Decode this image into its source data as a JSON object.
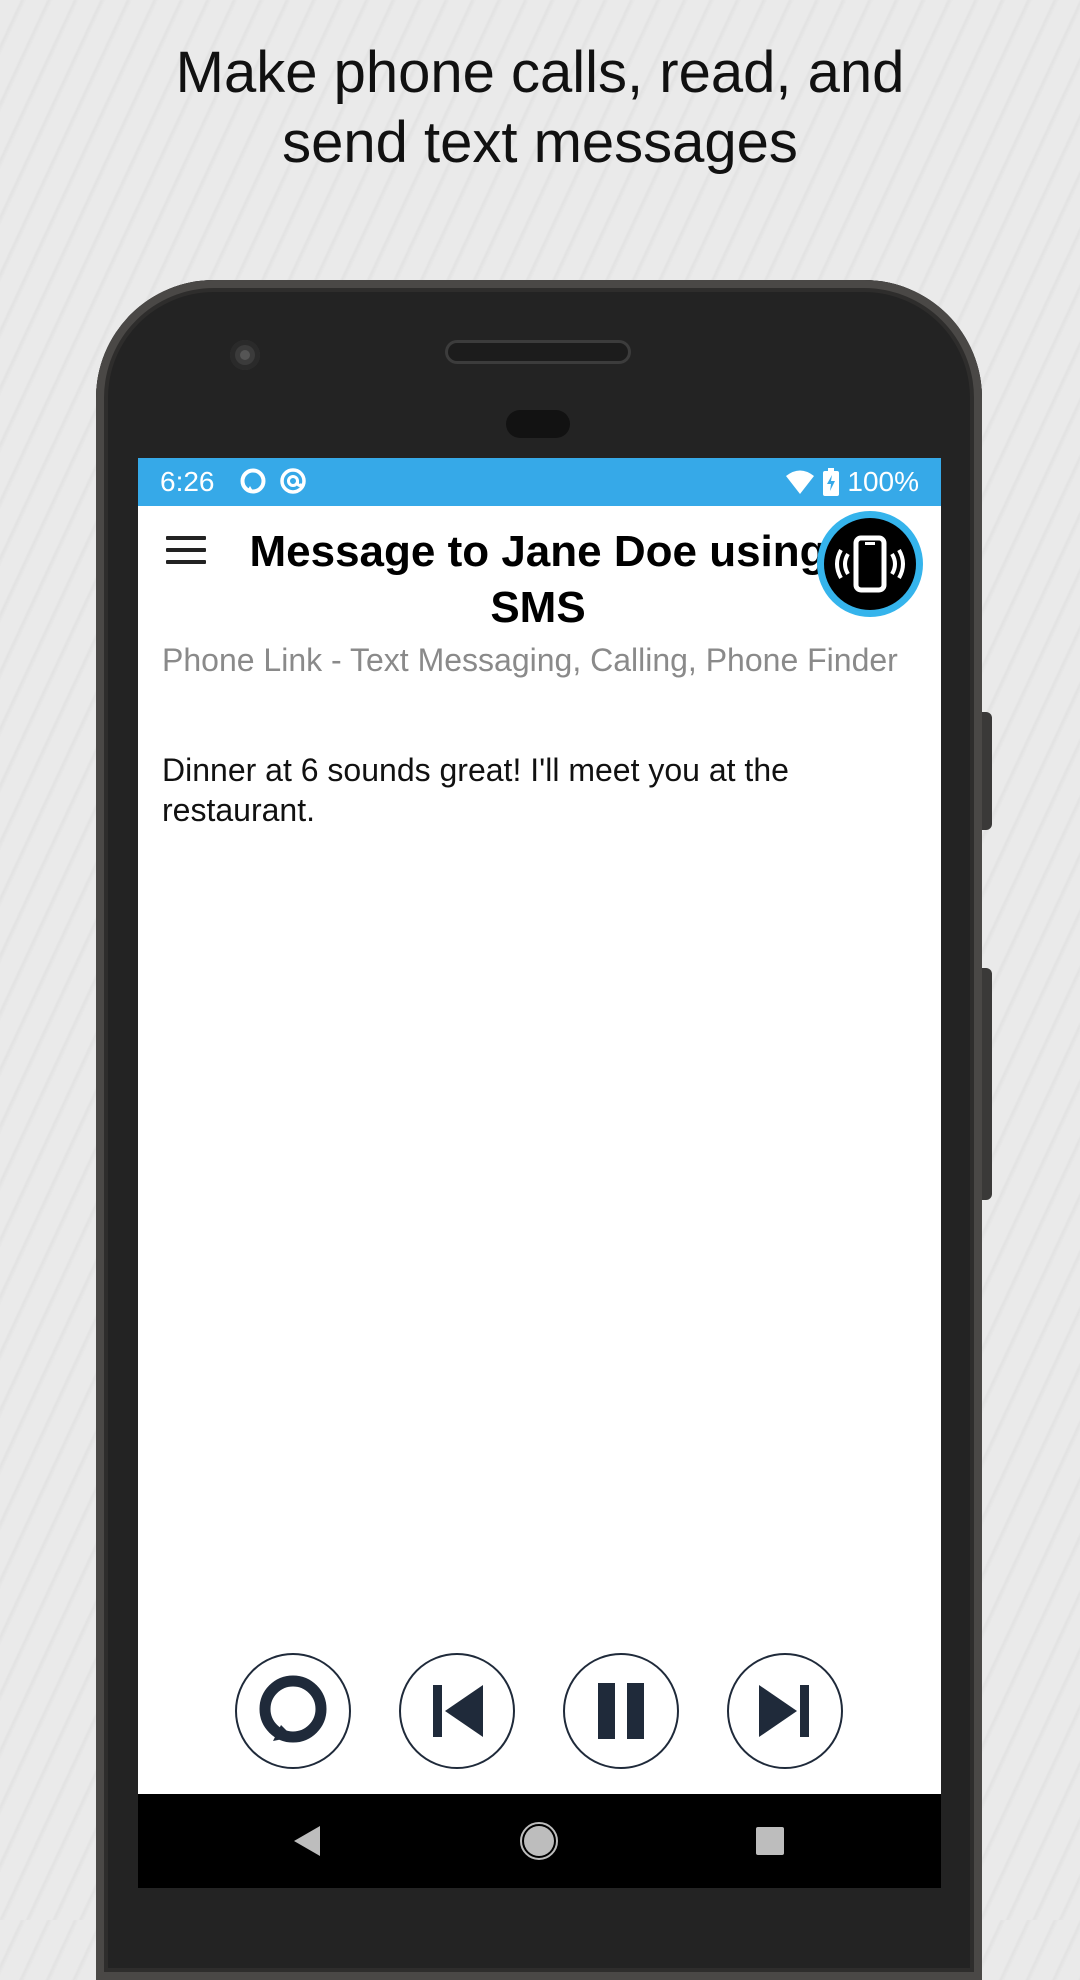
{
  "headline": {
    "line1": "Make phone calls, read, and",
    "line2": "send text messages"
  },
  "status_bar": {
    "time": "6:26",
    "battery": "100%",
    "icons": [
      "alexa-status-icon",
      "at-sign-status-icon",
      "wifi-icon",
      "battery-charging-icon"
    ],
    "color": "#36a9e8"
  },
  "app_bar": {
    "title": "Message to Jane Doe using SMS",
    "menu_icon": "hamburger-menu-icon",
    "fab_icon": "phone-vibrate-icon",
    "fab_ring_color": "#35b4ec"
  },
  "content": {
    "app_name": "Phone Link - Text Messaging, Calling, Phone Finder",
    "message": "Dinner at 6 sounds great! I'll meet you at the restaurant."
  },
  "controls": {
    "icons": [
      "alexa-icon",
      "skip-previous-icon",
      "pause-icon",
      "skip-next-icon"
    ],
    "color": "#1f2a3a"
  },
  "nav_bar": {
    "icons": [
      "back-icon",
      "home-icon",
      "recents-icon"
    ]
  }
}
